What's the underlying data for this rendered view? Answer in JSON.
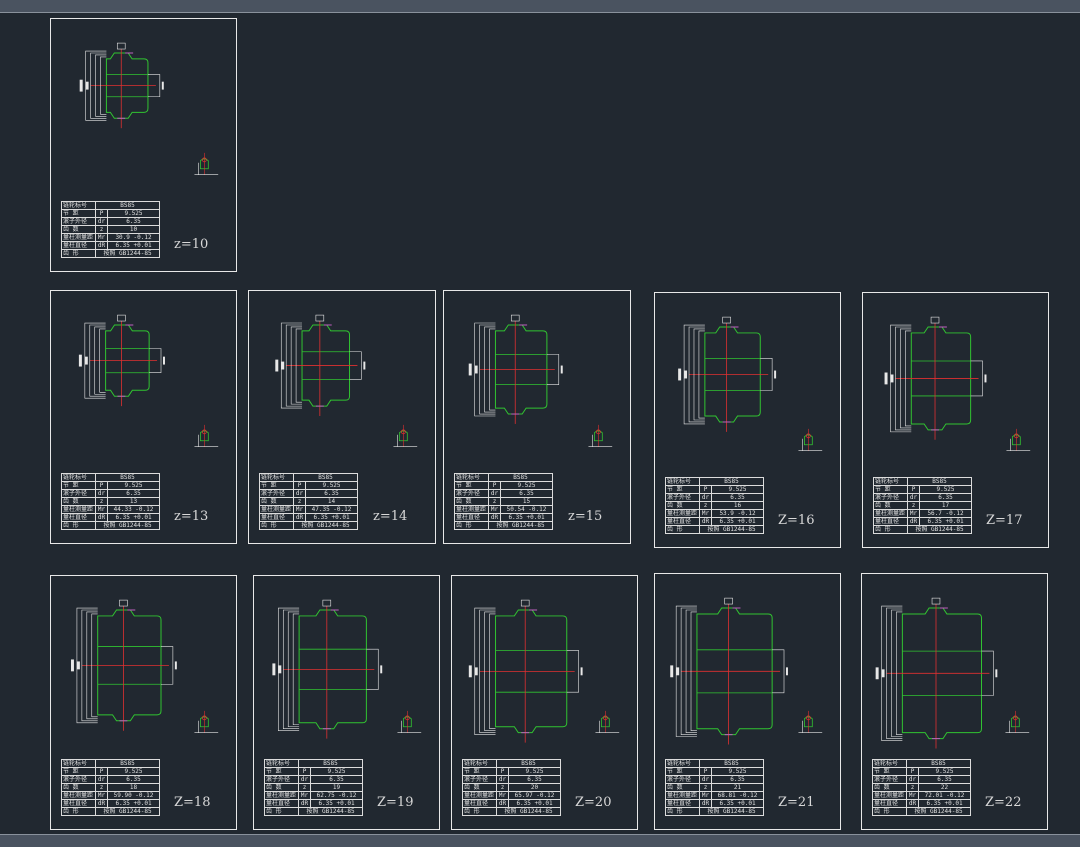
{
  "window": {
    "title": ""
  },
  "drawing_colors": {
    "background": "#212830",
    "frame": "#e8e8e8",
    "outline": "#31c431",
    "centerline": "#e03030",
    "dimension": "#e8e8e8",
    "marker": "#c060c0"
  },
  "table_labels": {
    "r0": "链轮标号",
    "r1": "节  距",
    "r2": "滚子外径",
    "r3": "齿  数",
    "r4": "量柱测量距",
    "r5": "量柱直径",
    "r6": "齿  形"
  },
  "table_syms": {
    "s1": "P",
    "s2": "dr",
    "s3": "z",
    "s4": "Mr",
    "s5": "dR"
  },
  "sheets": [
    {
      "label": "z=10",
      "vals": {
        "v0": "BS85",
        "v1": "9.525",
        "v2": "6.35",
        "v3": "10",
        "v4": "30.9 -0.12",
        "v5": "6.35 +0.01",
        "v6": "按照 GB1244-85"
      }
    },
    {
      "label": "z=13",
      "vals": {
        "v0": "BS85",
        "v1": "9.525",
        "v2": "6.35",
        "v3": "13",
        "v4": "44.33 -0.12",
        "v5": "6.35 +0.01",
        "v6": "按照 GB1244-85"
      }
    },
    {
      "label": "z=14",
      "vals": {
        "v0": "BS85",
        "v1": "9.525",
        "v2": "6.35",
        "v3": "14",
        "v4": "47.35 -0.12",
        "v5": "6.35 +0.01",
        "v6": "按照 GB1244-85"
      }
    },
    {
      "label": "z=15",
      "vals": {
        "v0": "BS85",
        "v1": "9.525",
        "v2": "6.35",
        "v3": "15",
        "v4": "50.54 -0.12",
        "v5": "6.35 +0.01",
        "v6": "按照 GB1244-85"
      }
    },
    {
      "label": "Z=16",
      "vals": {
        "v0": "BS85",
        "v1": "9.525",
        "v2": "6.35",
        "v3": "16",
        "v4": "53.9 -0.12",
        "v5": "6.35 +0.01",
        "v6": "按照 GB1244-85"
      }
    },
    {
      "label": "Z=17",
      "vals": {
        "v0": "BS85",
        "v1": "9.525",
        "v2": "6.35",
        "v3": "17",
        "v4": "56.7 -0.12",
        "v5": "6.35 +0.01",
        "v6": "按照 GB1244-85"
      }
    },
    {
      "label": "Z=18",
      "vals": {
        "v0": "BS85",
        "v1": "9.525",
        "v2": "6.35",
        "v3": "18",
        "v4": "59.90 -0.12",
        "v5": "6.35 +0.01",
        "v6": "按照 GB1244-85"
      }
    },
    {
      "label": "Z=19",
      "vals": {
        "v0": "BS85",
        "v1": "9.525",
        "v2": "6.35",
        "v3": "19",
        "v4": "62.75 -0.12",
        "v5": "6.35 +0.01",
        "v6": "按照 GB1244-85"
      }
    },
    {
      "label": "Z=20",
      "vals": {
        "v0": "BS85",
        "v1": "9.525",
        "v2": "6.35",
        "v3": "20",
        "v4": "65.97 -0.12",
        "v5": "6.35 +0.01",
        "v6": "按照 GB1244-85"
      }
    },
    {
      "label": "Z=21",
      "vals": {
        "v0": "BS85",
        "v1": "9.525",
        "v2": "6.35",
        "v3": "21",
        "v4": "68.81 -0.12",
        "v5": "6.35 +0.01",
        "v6": "按照 GB1244-85"
      }
    },
    {
      "label": "Z=22",
      "vals": {
        "v0": "BS85",
        "v1": "9.525",
        "v2": "6.35",
        "v3": "22",
        "v4": "72.01 -0.12",
        "v5": "6.35 +0.01",
        "v6": "按照 GB1244-85"
      }
    }
  ]
}
